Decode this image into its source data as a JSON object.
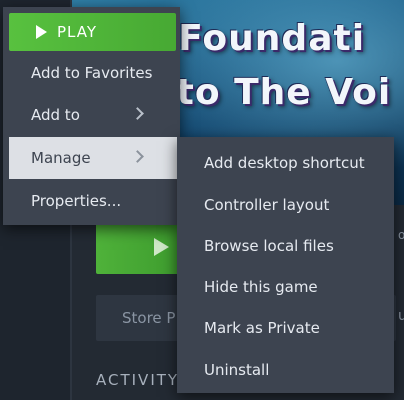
{
  "hero": {
    "line1": "d Foundati",
    "line2": "nto The Voi"
  },
  "main": {
    "store_label": "Store P",
    "activity_heading": "ACTIVITY",
    "edge_text_1": "o",
    "edge_text_2": "u"
  },
  "context_menu": {
    "play_label": "PLAY",
    "items": [
      {
        "label": "Add to Favorites",
        "has_submenu": false
      },
      {
        "label": "Add to",
        "has_submenu": true
      },
      {
        "label": "Manage",
        "has_submenu": true,
        "active": true
      },
      {
        "label": "Properties...",
        "has_submenu": false
      }
    ]
  },
  "manage_submenu": {
    "items": [
      {
        "label": "Add desktop shortcut"
      },
      {
        "label": "Controller layout"
      },
      {
        "label": "Browse local files"
      },
      {
        "label": "Hide this game"
      },
      {
        "label": "Mark as Private"
      },
      {
        "label": "Uninstall"
      }
    ]
  },
  "colors": {
    "play_green": "#58c13f",
    "menu_bg": "#3d4450",
    "menu_active_bg": "#dde0e5",
    "menu_text": "#e6eaf0"
  },
  "icons": {
    "play": "play-triangle-icon",
    "chevron": "chevron-right-icon"
  }
}
